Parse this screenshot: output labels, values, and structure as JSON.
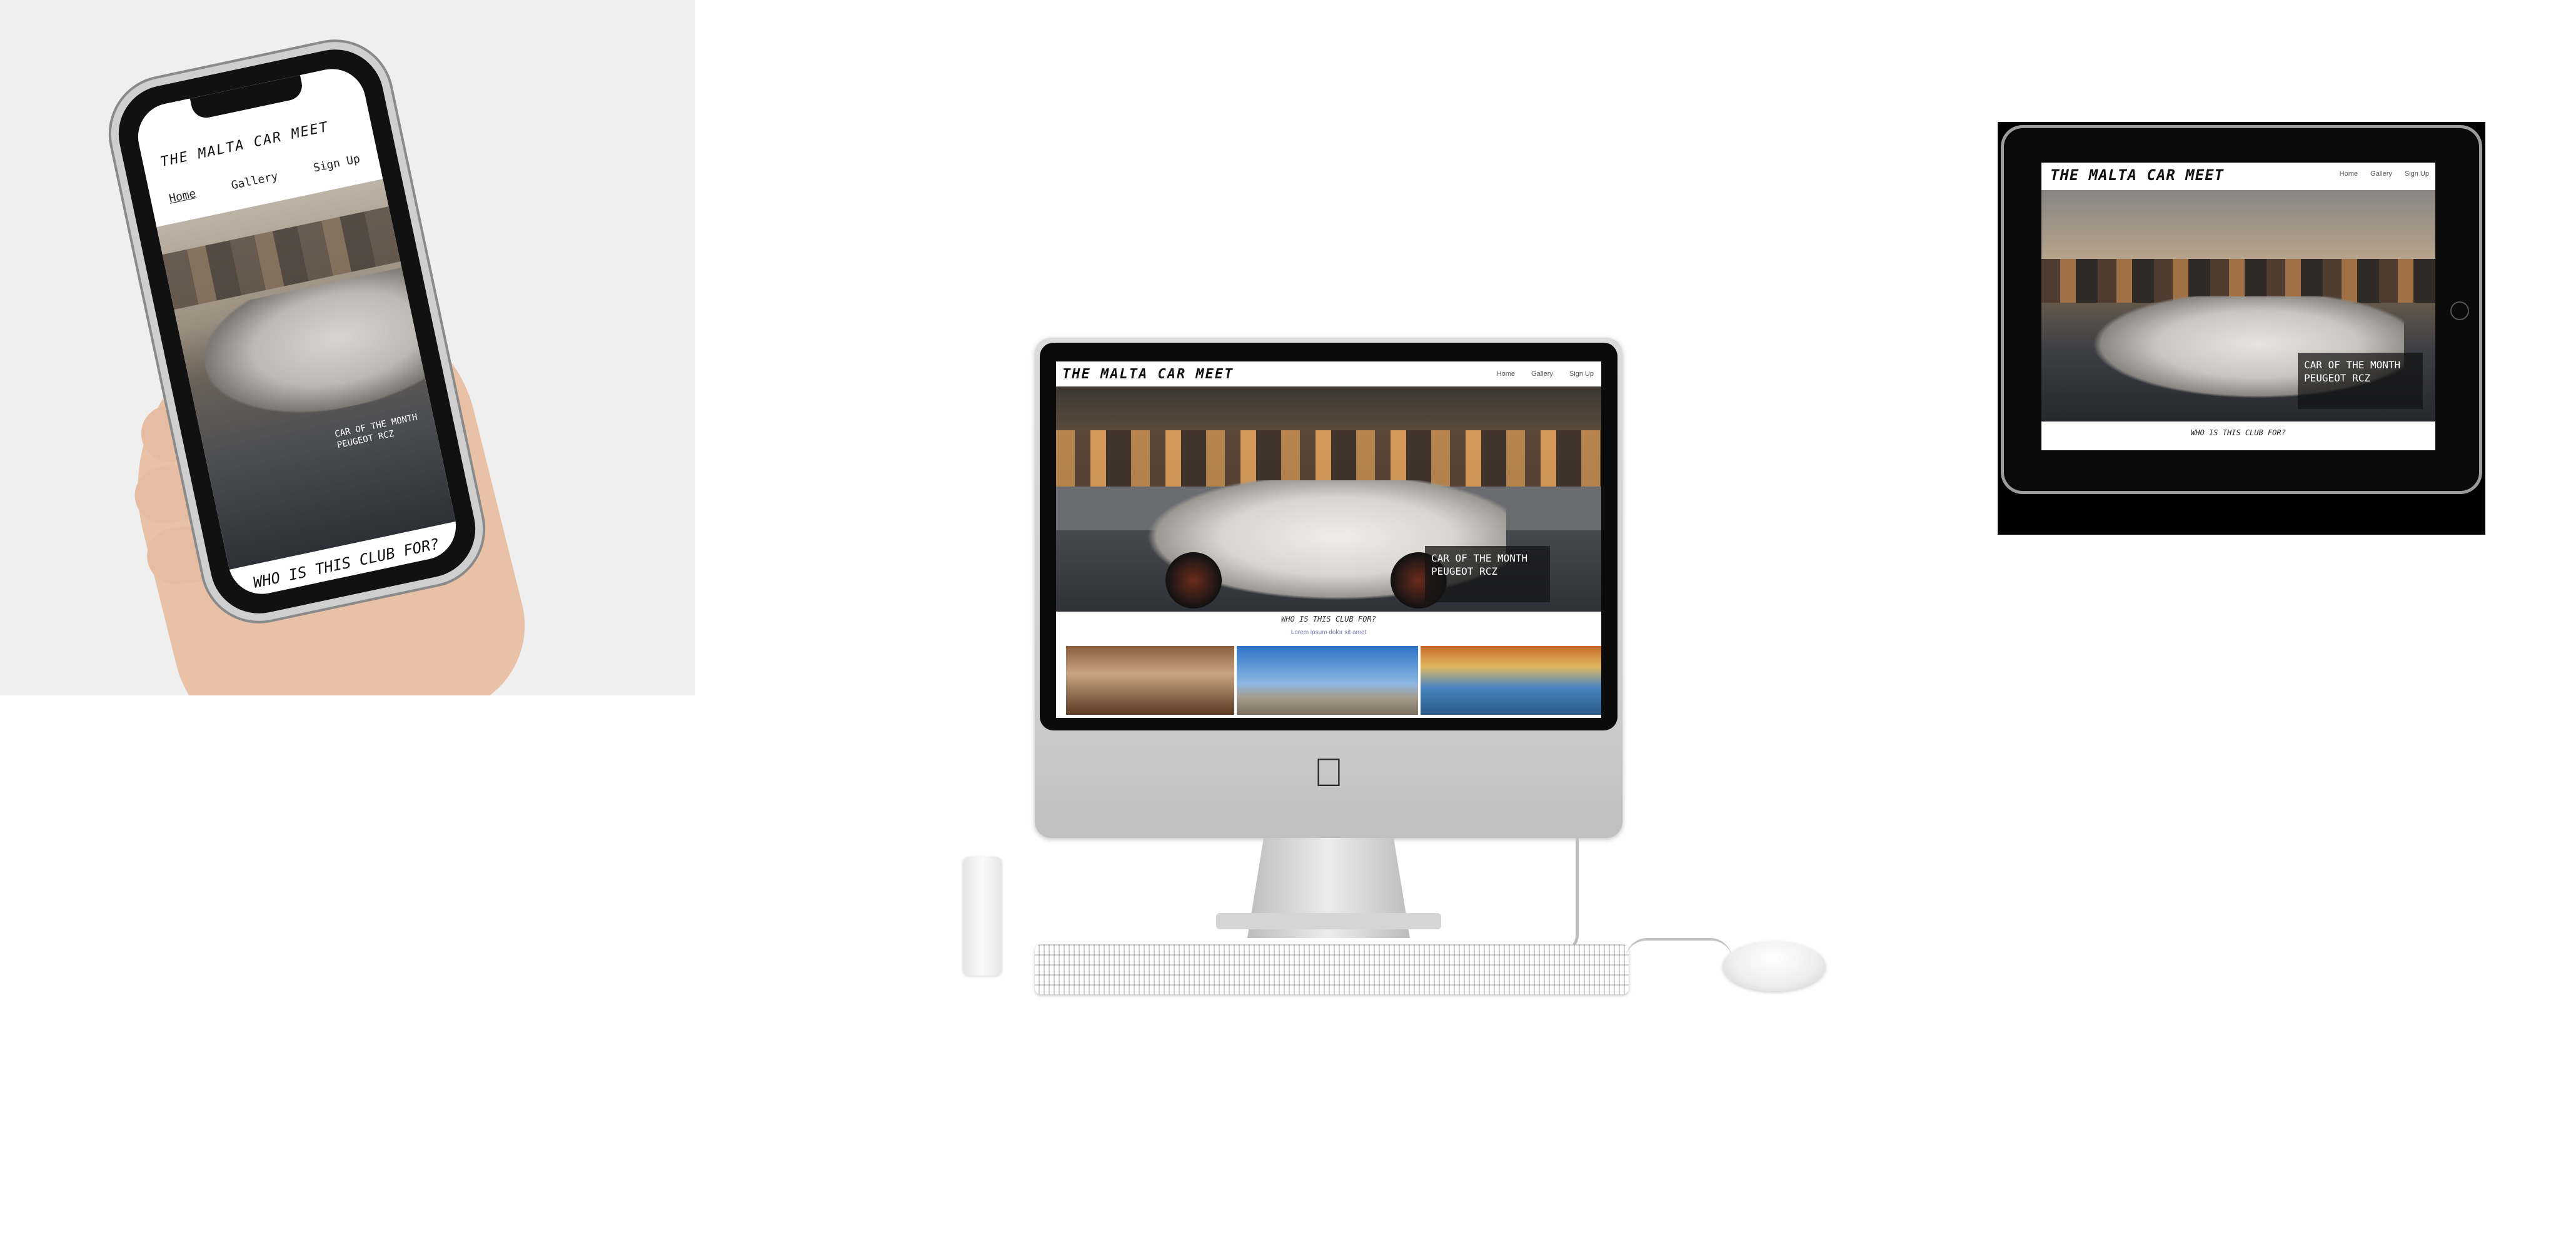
{
  "site": {
    "title": "THE MALTA CAR MEET",
    "nav": [
      "Home",
      "Gallery",
      "Sign Up"
    ],
    "hero_caption_line1": "CAR OF THE MONTH",
    "hero_caption_line2": "PEUGEOT RCZ",
    "section_heading": "WHO IS THIS CLUB FOR?",
    "section_subtext": "Lorem ipsum dolor sit amet"
  },
  "devices": [
    "phone",
    "imac",
    "tablet"
  ],
  "icons": [
    "apple-logo-icon",
    "home-button-icon"
  ]
}
